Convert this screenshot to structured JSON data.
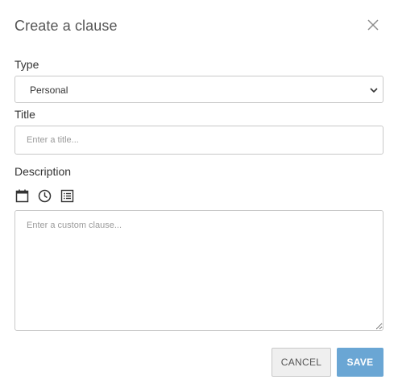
{
  "dialog": {
    "title": "Create a clause",
    "close_icon": "close-icon"
  },
  "type_field": {
    "label": "Type",
    "value": "Personal",
    "icon": "chevron-down-icon"
  },
  "title_field": {
    "label": "Title",
    "placeholder": "Enter a title..."
  },
  "description_field": {
    "label": "Description",
    "placeholder": "Enter a custom clause...",
    "toolbar": [
      {
        "icon": "calendar-icon"
      },
      {
        "icon": "clock-icon"
      },
      {
        "icon": "list-icon"
      }
    ]
  },
  "actions": {
    "cancel_label": "CANCEL",
    "save_label": "SAVE"
  },
  "colors": {
    "save_button": "#6aa6d4",
    "cancel_button": "#efefef",
    "border": "#c8c8c8",
    "placeholder": "#9a9a9a"
  }
}
